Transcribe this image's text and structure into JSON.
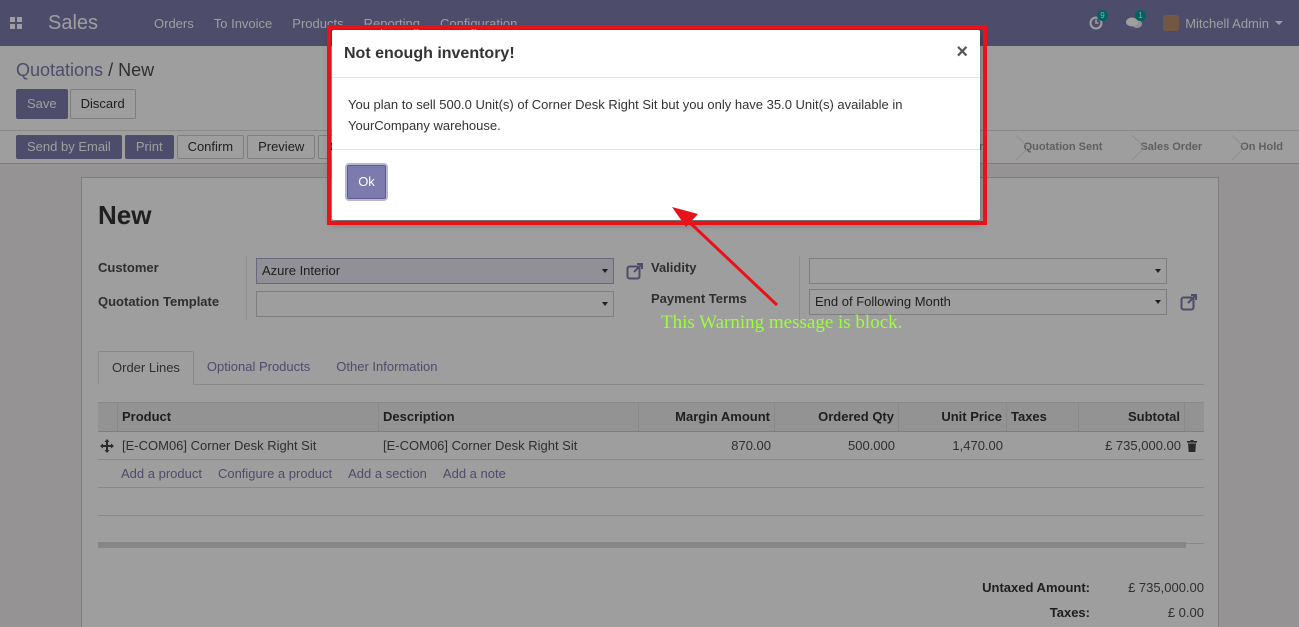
{
  "navbar": {
    "app_name": "Sales",
    "menu": [
      "Orders",
      "To Invoice",
      "Products",
      "Reporting",
      "Configuration"
    ],
    "activity_count": "9",
    "message_count": "1",
    "user_name": "Mitchell Admin"
  },
  "control": {
    "breadcrumb_parent": "Quotations",
    "breadcrumb_sep": "/",
    "breadcrumb_current": "New",
    "save_label": "Save",
    "discard_label": "Discard",
    "actions": {
      "send_email": "Send by Email",
      "print": "Print",
      "confirm": "Confirm",
      "preview": "Preview",
      "cancel_partial": "C"
    },
    "stages": [
      "ation",
      "Quotation Sent",
      "Sales Order",
      "On Hold"
    ]
  },
  "form": {
    "title": "New",
    "customer_label": "Customer",
    "customer_value": "Azure Interior",
    "template_label": "Quotation Template",
    "template_value": "",
    "validity_label": "Validity",
    "validity_value": "",
    "payment_terms_label": "Payment Terms",
    "payment_terms_value": "End of Following Month"
  },
  "tabs": [
    "Order Lines",
    "Optional Products",
    "Other Information"
  ],
  "table": {
    "headers": [
      "Product",
      "Description",
      "Margin Amount",
      "Ordered Qty",
      "Unit Price",
      "Taxes",
      "Subtotal"
    ],
    "rows": [
      {
        "product": "[E-COM06] Corner Desk Right Sit",
        "description": "[E-COM06] Corner Desk Right Sit",
        "margin": "870.00",
        "qty": "500.000",
        "unit_price": "1,470.00",
        "taxes": "",
        "subtotal": "£ 735,000.00"
      }
    ],
    "add_links": [
      "Add a product",
      "Configure a product",
      "Add a section",
      "Add a note"
    ]
  },
  "totals": {
    "untaxed_label": "Untaxed Amount:",
    "untaxed_value": "£ 735,000.00",
    "taxes_label": "Taxes:",
    "taxes_value": "£ 0.00"
  },
  "modal": {
    "title": "Not enough inventory!",
    "close": "×",
    "message": "You plan to sell 500.0 Unit(s) of Corner Desk Right Sit but you only have 35.0 Unit(s) available in YourCompany warehouse.",
    "ok_label": "Ok"
  },
  "annotation": {
    "text": "This Warning message is block.",
    "color": "#9cff3a",
    "box_color": "#e8121b"
  },
  "colors": {
    "brand": "#7c7bad"
  }
}
